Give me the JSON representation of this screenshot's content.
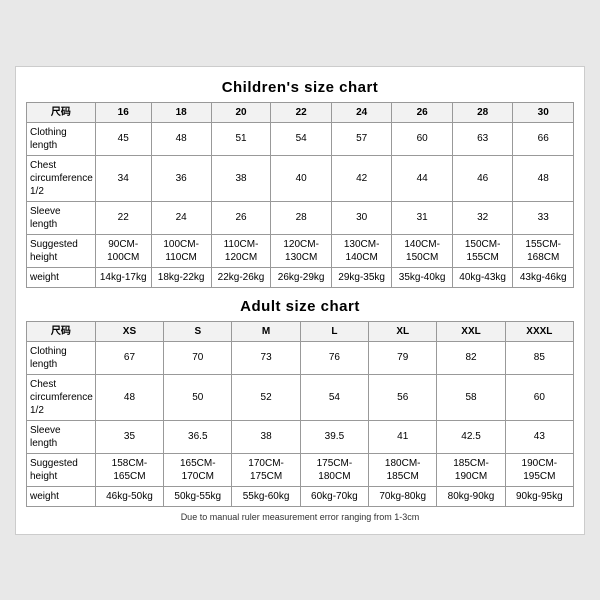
{
  "children_chart": {
    "title": "Children's size chart",
    "columns": [
      "尺码",
      "16",
      "18",
      "20",
      "22",
      "24",
      "26",
      "28",
      "30"
    ],
    "rows": [
      {
        "label": "Clothing\nlength",
        "values": [
          "45",
          "48",
          "51",
          "54",
          "57",
          "60",
          "63",
          "66"
        ]
      },
      {
        "label": "Chest\ncircumference\n1/2",
        "values": [
          "34",
          "36",
          "38",
          "40",
          "42",
          "44",
          "46",
          "48"
        ]
      },
      {
        "label": "Sleeve\nlength",
        "values": [
          "22",
          "24",
          "26",
          "28",
          "30",
          "31",
          "32",
          "33"
        ]
      },
      {
        "label": "Suggested\nheight",
        "values": [
          "90CM-100CM",
          "100CM-110CM",
          "110CM-120CM",
          "120CM-130CM",
          "130CM-140CM",
          "140CM-150CM",
          "150CM-155CM",
          "155CM-168CM"
        ]
      },
      {
        "label": "weight",
        "values": [
          "14kg-17kg",
          "18kg-22kg",
          "22kg-26kg",
          "26kg-29kg",
          "29kg-35kg",
          "35kg-40kg",
          "40kg-43kg",
          "43kg-46kg"
        ]
      }
    ]
  },
  "adult_chart": {
    "title": "Adult size chart",
    "columns": [
      "尺码",
      "XS",
      "S",
      "M",
      "L",
      "XL",
      "XXL",
      "XXXL"
    ],
    "rows": [
      {
        "label": "Clothing\nlength",
        "values": [
          "67",
          "70",
          "73",
          "76",
          "79",
          "82",
          "85"
        ]
      },
      {
        "label": "Chest\ncircumference\n1/2",
        "values": [
          "48",
          "50",
          "52",
          "54",
          "56",
          "58",
          "60"
        ]
      },
      {
        "label": "Sleeve\nlength",
        "values": [
          "35",
          "36.5",
          "38",
          "39.5",
          "41",
          "42.5",
          "43"
        ]
      },
      {
        "label": "Suggested\nheight",
        "values": [
          "158CM-165CM",
          "165CM-170CM",
          "170CM-175CM",
          "175CM-180CM",
          "180CM-185CM",
          "185CM-190CM",
          "190CM-195CM"
        ]
      },
      {
        "label": "weight",
        "values": [
          "46kg-50kg",
          "50kg-55kg",
          "55kg-60kg",
          "60kg-70kg",
          "70kg-80kg",
          "80kg-90kg",
          "90kg-95kg"
        ]
      }
    ]
  },
  "footnote": "Due to manual ruler measurement error ranging from 1-3cm"
}
